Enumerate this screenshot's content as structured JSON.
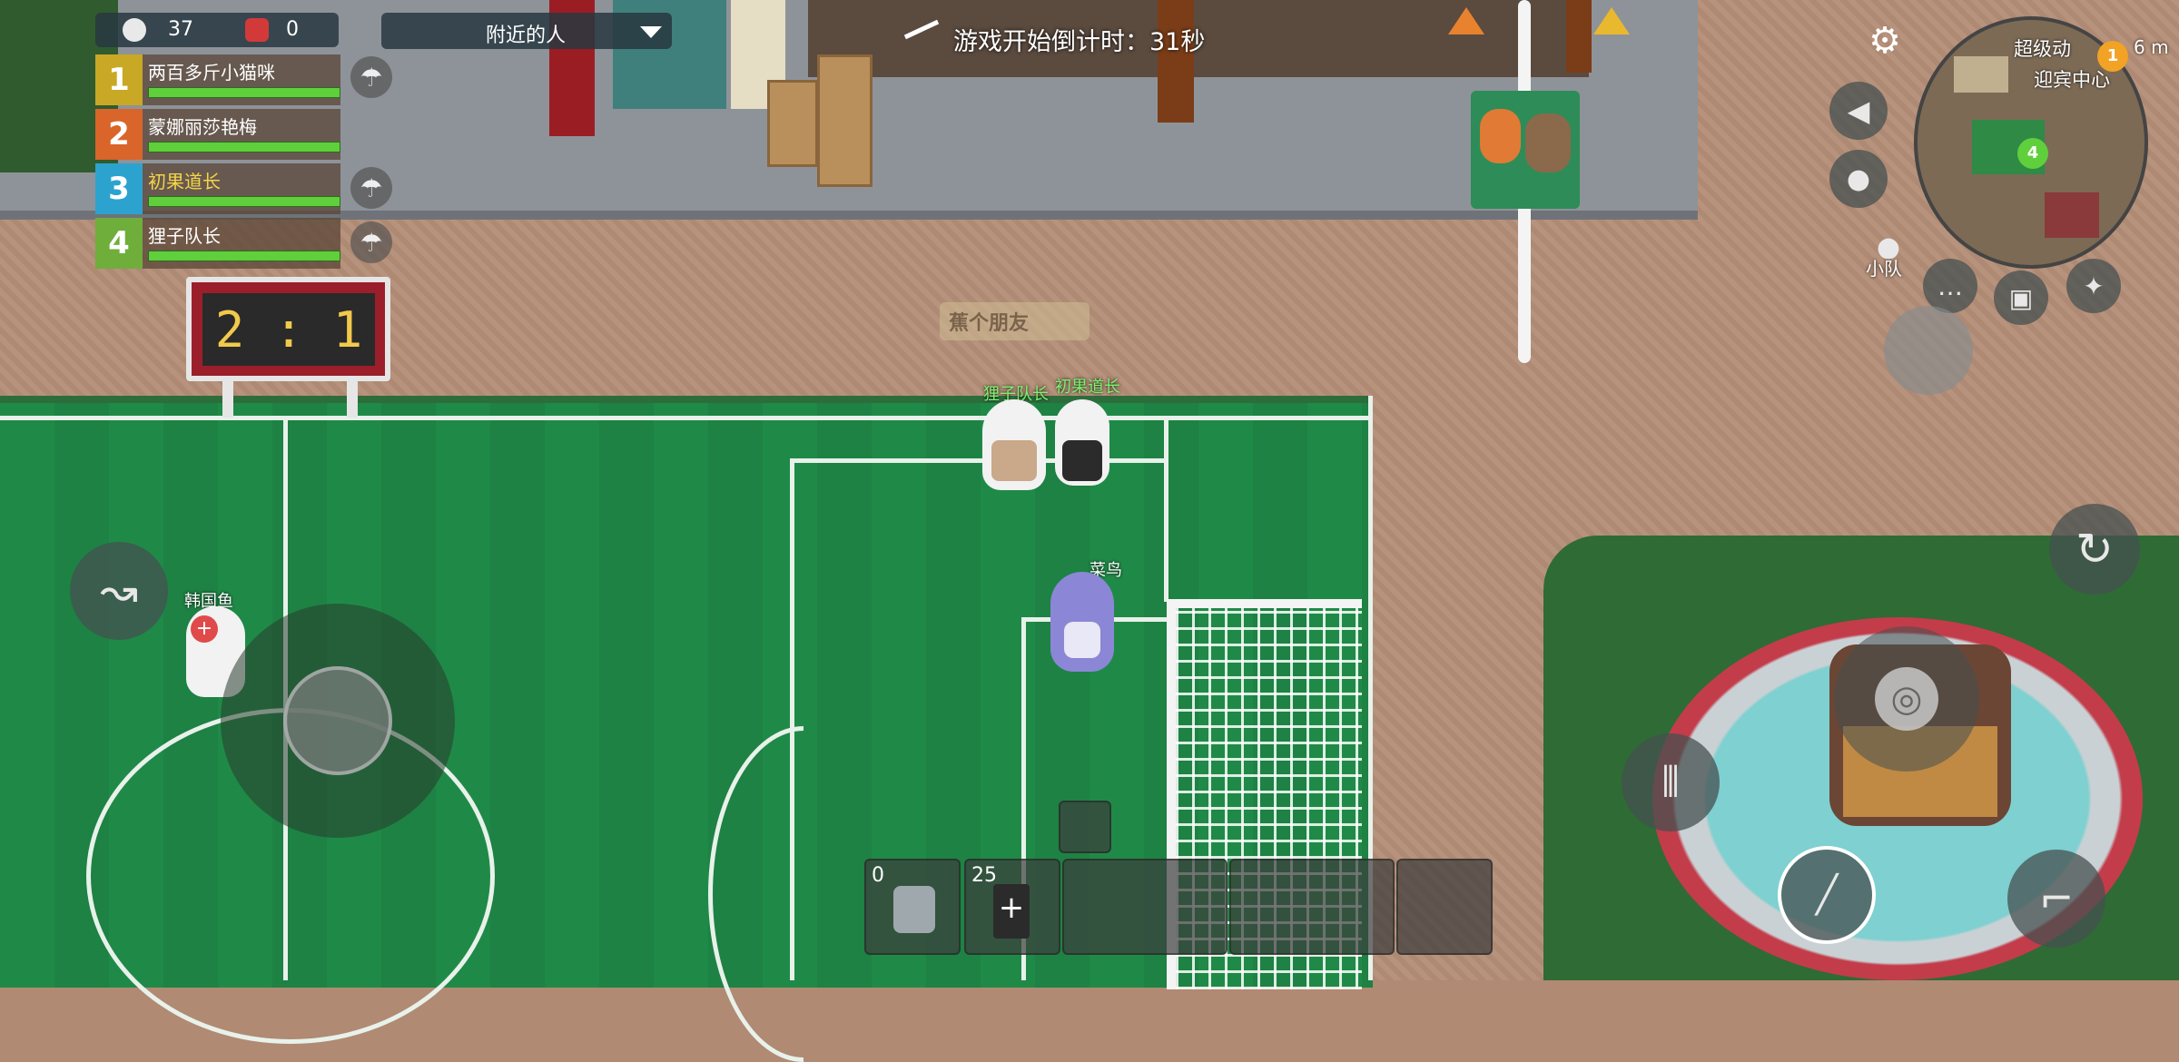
{
  "hud": {
    "player_count": "37",
    "kill_count": "0",
    "nearby_dropdown": "附近的人",
    "countdown": "游戏开始倒计时：31秒",
    "ranking": [
      {
        "rank": "1",
        "name": "两百多斤小猫咪",
        "rank_color": "#c9a825",
        "name_color": "#ffffff"
      },
      {
        "rank": "2",
        "name": "蒙娜丽莎艳梅",
        "rank_color": "#d9652a",
        "name_color": "#ffffff"
      },
      {
        "rank": "3",
        "name": "初果道长",
        "rank_color": "#2ca3cf",
        "name_color": "#f5d547"
      },
      {
        "rank": "4",
        "name": "狸子队长",
        "rank_color": "#6fae3b",
        "name_color": "#ffffff"
      }
    ],
    "score": "2 : 1",
    "minimap": {
      "label_1": "超级动",
      "label_2": "迎宾中心",
      "badge_1": "1",
      "badge_2": "4",
      "distance": "6 m"
    },
    "team_label": "小队",
    "slots": [
      {
        "count": "0",
        "item": "bandage-icon"
      },
      {
        "count": "25",
        "item": "drink-icon"
      },
      {
        "count": "",
        "item": ""
      },
      {
        "count": "",
        "item": ""
      },
      {
        "count": "",
        "item": ""
      }
    ]
  },
  "world": {
    "sign_text": "蕉个朋友",
    "characters": [
      {
        "name": "狸子队长",
        "label_color": "#7cf26e"
      },
      {
        "name": "初果道长",
        "label_color": "#7cf26e"
      },
      {
        "name": "菜鸟",
        "label_color": "#ffffff"
      },
      {
        "name": "韩国鱼",
        "label_color": "#ffffff"
      }
    ]
  },
  "colors": {
    "accent": "#f5d547",
    "health": "#5fcf3b",
    "field": "#1f8a47"
  }
}
